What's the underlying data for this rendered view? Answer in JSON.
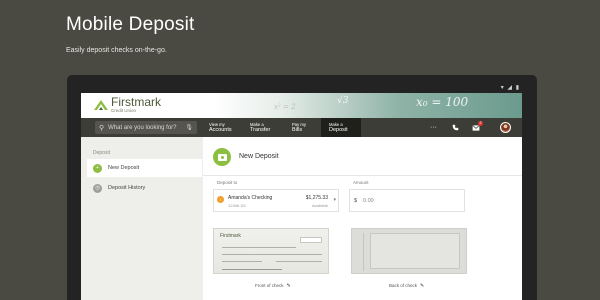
{
  "hero": {
    "title": "Mobile Deposit",
    "subtitle": "Easily deposit checks on-the-go."
  },
  "status_bar": {
    "icons": "▾ ◢ ▮"
  },
  "brand": {
    "name": "Firstmark",
    "tagline": "Credit Union",
    "chalk": [
      "x² = 2",
      "x₀ = 100",
      "√3"
    ]
  },
  "nav": {
    "search_placeholder": "What are you looking for?",
    "search_icon": "search-icon",
    "mic_icon": "microphone-icon",
    "items": [
      {
        "small": "View my",
        "big": "Accounts"
      },
      {
        "small": "Make a",
        "big": "Transfer"
      },
      {
        "small": "Pay my",
        "big": "Bills"
      },
      {
        "small": "Make a",
        "big": "Deposit"
      }
    ],
    "more": "···",
    "phone_icon": "phone-icon",
    "mail_icon": "mail-icon",
    "mail_badge": "2"
  },
  "sidebar": {
    "heading": "Deposit",
    "items": [
      {
        "label": "New Deposit",
        "icon": "plus-circle-icon",
        "glyph": "+"
      },
      {
        "label": "Deposit History",
        "icon": "history-icon",
        "glyph": "◷"
      }
    ]
  },
  "content": {
    "title": "New Deposit",
    "deposit_to_label": "Deposit to",
    "account": {
      "name": "Amanda's Checking",
      "number": "12456-3/1",
      "balance": "$1,275.33",
      "avail": "Available",
      "initial": "!"
    },
    "amount_label": "Amount",
    "amount_symbol": "$",
    "amount_value": "0.00",
    "front_caption": "Front of check",
    "back_caption": "Back of check",
    "check_logo": "Firstmark"
  },
  "colors": {
    "accent_green": "#8cbf3f",
    "account_orange": "#f39c2b",
    "nav_bg": "#3d3d38",
    "page_bg": "#4a4a42"
  }
}
